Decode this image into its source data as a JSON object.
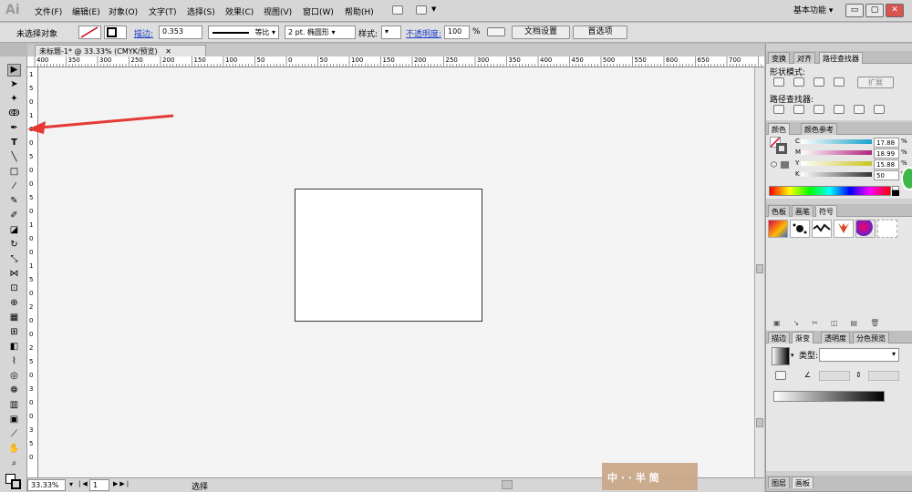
{
  "app": {
    "logo": "Ai",
    "workspace": "基本功能",
    "menus": [
      "文件(F)",
      "编辑(E)",
      "对象(O)",
      "文字(T)",
      "选择(S)",
      "效果(C)",
      "视图(V)",
      "窗口(W)",
      "帮助(H)"
    ],
    "window_buttons": [
      "▭",
      "▢",
      "✕"
    ]
  },
  "control": {
    "selection_status": "未选择对象",
    "stroke_label": "描边:",
    "stroke_weight": "0.353",
    "stroke_profile": "等比",
    "brush": "2 pt. 椭圆形",
    "style_label": "样式:",
    "opacity_label": "不透明度:",
    "opacity_value": "100",
    "opacity_unit": "%",
    "doc_setup": "文档设置",
    "preferences": "首选项"
  },
  "document": {
    "tab_title": "未标题-1* @ 33.33% (CMYK/预览)",
    "close": "✕",
    "h_ruler_ticks": [
      "400",
      "350",
      "300",
      "250",
      "200",
      "150",
      "100",
      "50",
      "0",
      "50",
      "100",
      "150",
      "200",
      "250",
      "300",
      "350",
      "400",
      "450",
      "500",
      "550",
      "600",
      "650",
      "700"
    ],
    "v_ruler_ticks": [
      "1",
      "5",
      "0",
      "1",
      "0",
      "0",
      "5",
      "0",
      "0",
      "5",
      "0",
      "1",
      "0",
      "0",
      "1",
      "5",
      "0",
      "2",
      "0",
      "0",
      "2",
      "5",
      "0",
      "3",
      "0",
      "0",
      "3",
      "5",
      "0"
    ]
  },
  "status": {
    "zoom": "33.33%",
    "page": "1",
    "tool": "选择"
  },
  "panels": {
    "transform_tabs": [
      "变换",
      "对齐",
      "路径查找器"
    ],
    "shape_modes_label": "形状模式:",
    "expand_button": "扩展",
    "pathfinders_label": "路径查找器:",
    "color_tabs": [
      "颜色",
      "颜色参考"
    ],
    "cmyk": [
      {
        "channel": "C",
        "value": "17.88",
        "color": "#19a2c9"
      },
      {
        "channel": "M",
        "value": "18.99",
        "color": "#b0237e"
      },
      {
        "channel": "Y",
        "value": "15.88",
        "color": "#c8c41f"
      },
      {
        "channel": "K",
        "value": "50",
        "color": "#333333"
      }
    ],
    "percent": "%",
    "swatch_tabs": [
      "色板",
      "画笔",
      "符号"
    ],
    "gradient_tabs": [
      "描边",
      "渐变",
      "透明度",
      "分色预览"
    ],
    "gradient_type_label": "类型:",
    "bottom_tabs": [
      "图层",
      "画板"
    ]
  },
  "watermark": "中 · · 半 简"
}
